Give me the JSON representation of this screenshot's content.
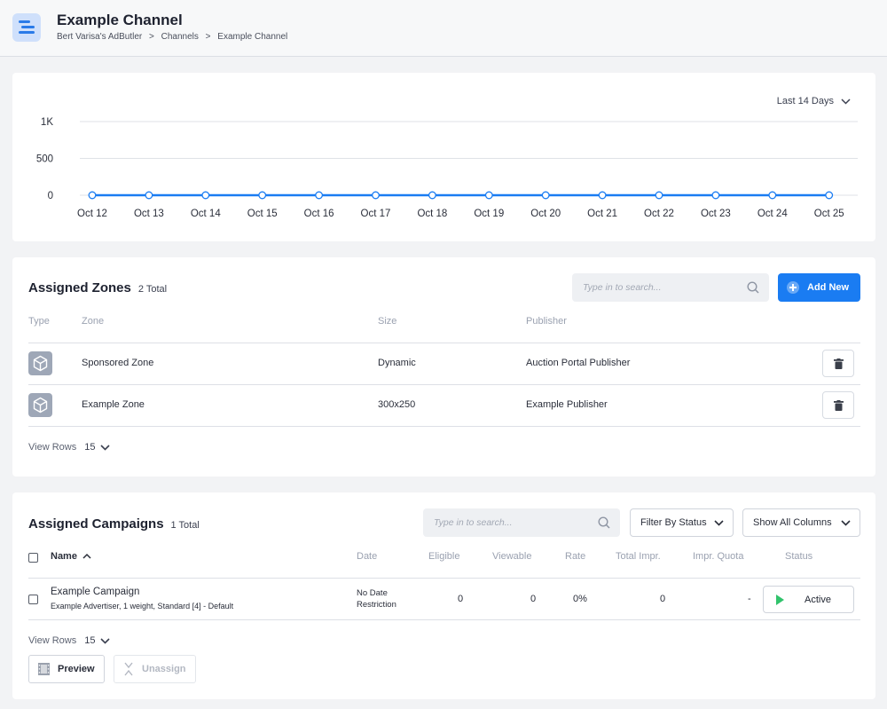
{
  "header": {
    "title": "Example Channel",
    "breadcrumb": [
      "Bert Varisa's AdButler",
      "Channels",
      "Example Channel"
    ],
    "breadcrumb_separator": ">"
  },
  "chart_card": {
    "range_label": "Last 14 Days"
  },
  "chart_data": {
    "type": "line",
    "categories": [
      "Oct 12",
      "Oct 13",
      "Oct 14",
      "Oct 15",
      "Oct 16",
      "Oct 17",
      "Oct 18",
      "Oct 19",
      "Oct 20",
      "Oct 21",
      "Oct 22",
      "Oct 23",
      "Oct 24",
      "Oct 25"
    ],
    "series": [
      {
        "values": [
          0,
          0,
          0,
          0,
          0,
          0,
          0,
          0,
          0,
          0,
          0,
          0,
          0,
          0
        ],
        "color": "#1a7cf2"
      }
    ],
    "yticks": [
      {
        "value": 0,
        "label": "0"
      },
      {
        "value": 500,
        "label": "500"
      },
      {
        "value": 1000,
        "label": "1K"
      }
    ],
    "ylim": [
      0,
      1000
    ],
    "grid": true
  },
  "zones": {
    "title": "Assigned Zones",
    "count": "2 Total",
    "search_placeholder": "Type in to search...",
    "add_label": "Add New",
    "columns": {
      "type": "Type",
      "zone": "Zone",
      "size": "Size",
      "publisher": "Publisher"
    },
    "rows": [
      {
        "icon": "cube-icon",
        "zone": "Sponsored Zone",
        "size": "Dynamic",
        "publisher": "Auction Portal Publisher"
      },
      {
        "icon": "cube-icon",
        "zone": "Example Zone",
        "size": "300x250",
        "publisher": "Example Publisher"
      }
    ],
    "view_rows_label": "View Rows",
    "view_rows_value": "15"
  },
  "campaigns": {
    "title": "Assigned Campaigns",
    "count": "1 Total",
    "search_placeholder": "Type in to search...",
    "filter_label": "Filter By Status",
    "columns_label": "Show All Columns",
    "columns": {
      "name": "Name",
      "date": "Date",
      "eligible": "Eligible",
      "viewable": "Viewable",
      "rate": "Rate",
      "total": "Total Impr.",
      "quota": "Impr. Quota",
      "status": "Status"
    },
    "rows": [
      {
        "name": "Example Campaign",
        "details": "Example Advertiser, 1 weight, Standard [4] - Default",
        "date_line1": "No Date",
        "date_line2": "Restriction",
        "eligible": "0",
        "viewable": "0",
        "rate": "0%",
        "total": "0",
        "quota": "-",
        "status": "Active"
      }
    ],
    "view_rows_label": "View Rows",
    "view_rows_value": "15",
    "preview_label": "Preview",
    "unassign_label": "Unassign"
  }
}
